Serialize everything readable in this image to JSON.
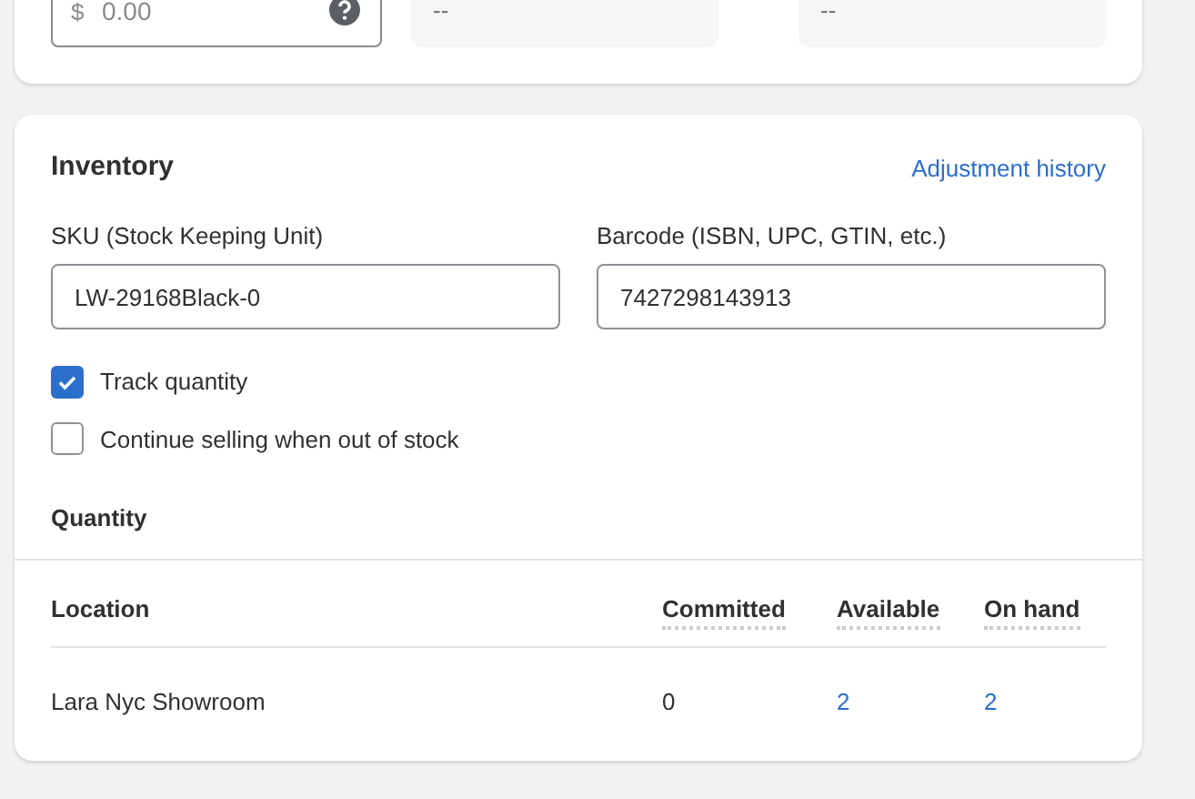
{
  "pricing": {
    "cost_field": {
      "prefix": "$",
      "placeholder": "0.00"
    },
    "summary": [
      "--",
      "--"
    ]
  },
  "inventory": {
    "title": "Inventory",
    "link": "Adjustment history",
    "fields": [
      {
        "label": "SKU (Stock Keeping Unit)",
        "value": "LW-29168Black-0"
      },
      {
        "label": "Barcode (ISBN, UPC, GTIN, etc.)",
        "value": "7427298143913"
      }
    ],
    "options": [
      {
        "label": "Track quantity",
        "checked": true
      },
      {
        "label": "Continue selling when out of stock",
        "checked": false
      }
    ],
    "quantity_title": "Quantity",
    "table": {
      "columns": [
        "Location",
        "Committed",
        "Available",
        "On hand"
      ],
      "rows": [
        [
          "Lara Nyc Showroom",
          "0",
          "2",
          "2"
        ]
      ]
    }
  }
}
